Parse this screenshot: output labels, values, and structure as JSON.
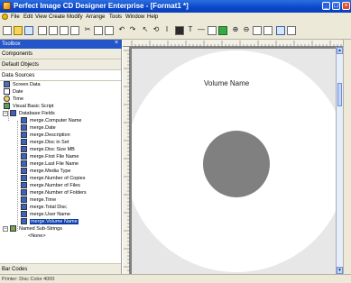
{
  "window": {
    "title": "Perfect Image CD Designer Enterprise - [Format1 *]"
  },
  "menubar": {
    "items": [
      "File",
      "Edit",
      "View",
      "Create",
      "Modify",
      "Arrange",
      "Tools",
      "Window",
      "Help"
    ]
  },
  "panel": {
    "title": "Toolbox",
    "sections": [
      "Components",
      "Default Objects",
      "Data Sources"
    ],
    "tree": {
      "top_items": [
        "Screen Data",
        "Date",
        "Time",
        "Visual Basic Script",
        "Database Fields"
      ],
      "fields": [
        "merge.Computer Name",
        "merge.Date",
        "merge.Description",
        "merge.Disc in Set",
        "merge.Disc Size MB",
        "merge.First File Name",
        "merge.Last File Name",
        "merge.Media Type",
        "merge.Number of Copies",
        "merge.Number of Files",
        "merge.Number of Folders",
        "merge.Time",
        "merge.Total Disc",
        "merge.User Name",
        "merge.Volume Name"
      ],
      "selected_field": "merge.Volume Name",
      "named_group": "Named Sub-Strings",
      "named_none": "<None>"
    },
    "bottom_section": "Bar Codes"
  },
  "canvas": {
    "cd_text": "Volume Name"
  },
  "status": {
    "text": "Printer: Disc Color 4000"
  }
}
